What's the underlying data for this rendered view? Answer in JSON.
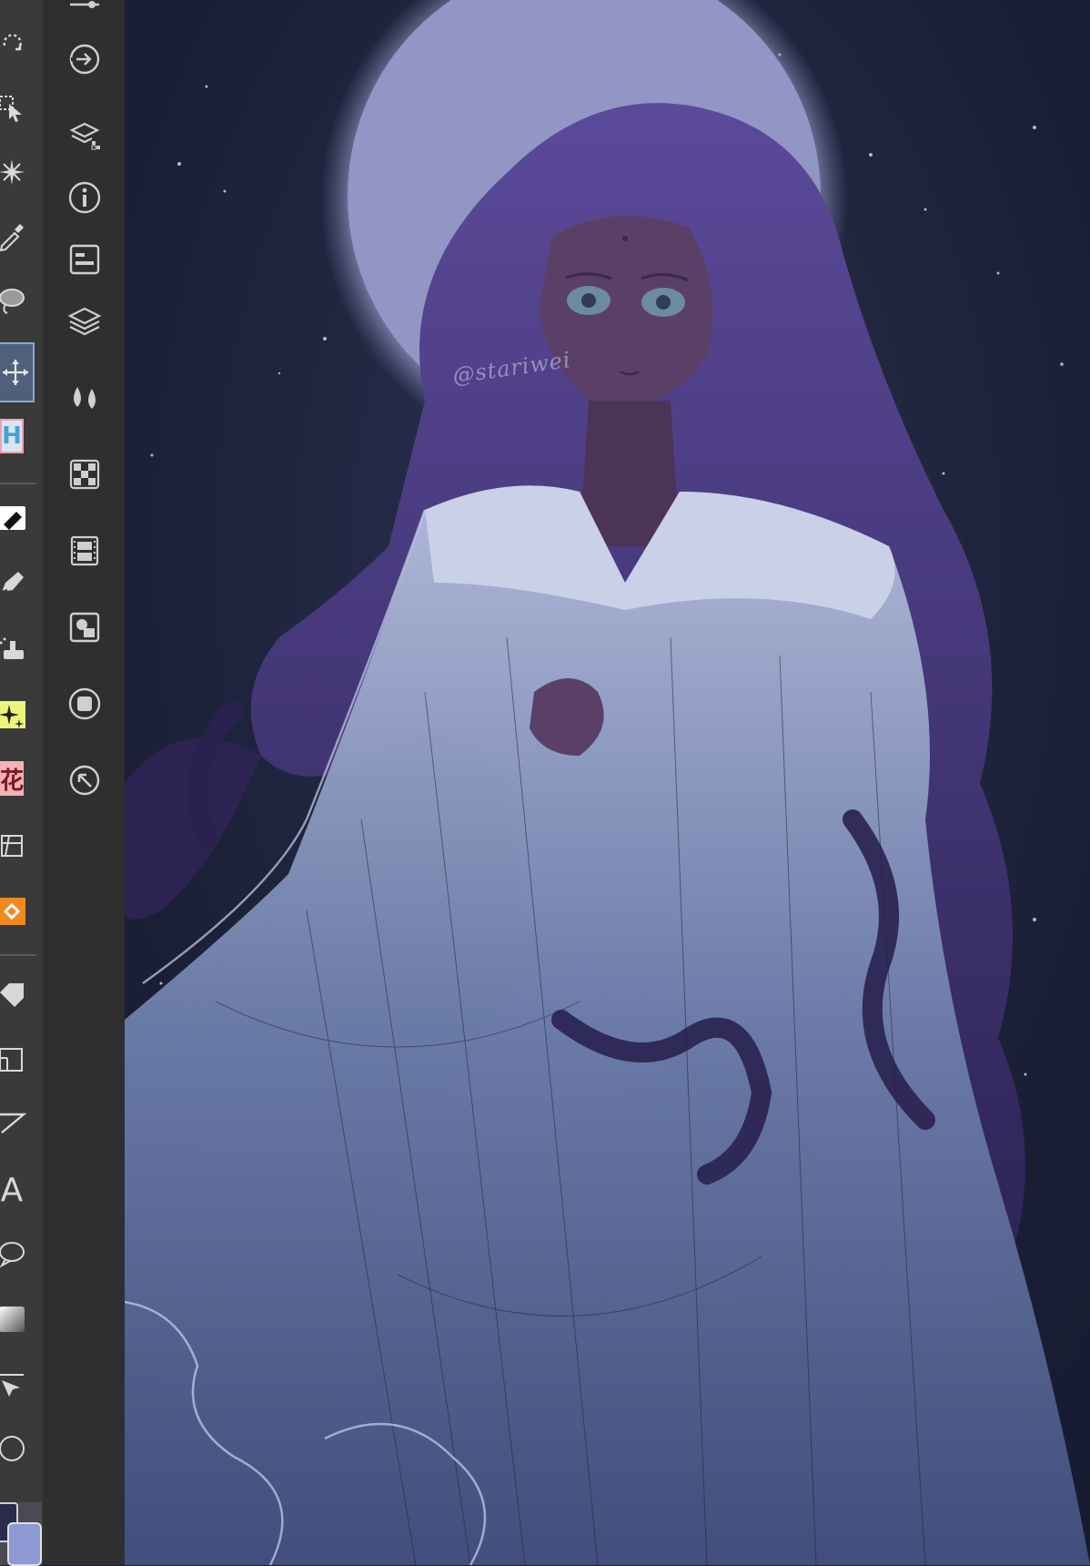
{
  "app": {
    "canvas_watermark": "@stariwei"
  },
  "tool_strip": {
    "tools": [
      {
        "icon": "rotate-icon"
      },
      {
        "icon": "object-select-icon"
      },
      {
        "icon": "sparkle-effect-icon"
      },
      {
        "icon": "eyedropper-icon"
      },
      {
        "icon": "lasso-fill-icon"
      },
      {
        "icon": "move-icon",
        "selected": true
      },
      {
        "icon": "frame-h-icon"
      },
      {
        "icon": "eraser-icon"
      },
      {
        "icon": "pen-icon"
      },
      {
        "icon": "airbrush-icon"
      },
      {
        "icon": "decoration-sparkle-icon"
      },
      {
        "icon": "flower-decoration-icon"
      },
      {
        "icon": "3d-figure-icon"
      },
      {
        "icon": "fill-bucket-icon"
      },
      {
        "icon": "tag-icon"
      },
      {
        "icon": "ruler-icon"
      },
      {
        "icon": "line-tool-icon"
      },
      {
        "icon": "text-tool-icon"
      },
      {
        "icon": "balloon-icon"
      },
      {
        "icon": "gradient-icon"
      },
      {
        "icon": "vector-select-icon"
      },
      {
        "icon": "ellipse-icon"
      }
    ],
    "frame_label": "H",
    "flower_label": "花",
    "text_label": "A",
    "colors": {
      "foreground": "#2c2b4d",
      "background": "#8d9ad3",
      "accent": "#8aa6d0"
    }
  },
  "palette_bar": {
    "buttons": [
      {
        "icon": "layer-transfer-icon"
      },
      {
        "icon": "material-icon"
      },
      {
        "icon": "info-icon"
      },
      {
        "icon": "layer-property-icon"
      },
      {
        "icon": "layers-icon"
      },
      {
        "icon": "brush-size-icon"
      },
      {
        "icon": "color-set-icon"
      },
      {
        "icon": "animation-timeline-icon"
      },
      {
        "icon": "sub-view-icon"
      },
      {
        "icon": "navigator-icon"
      },
      {
        "icon": "search-layer-icon"
      }
    ]
  }
}
